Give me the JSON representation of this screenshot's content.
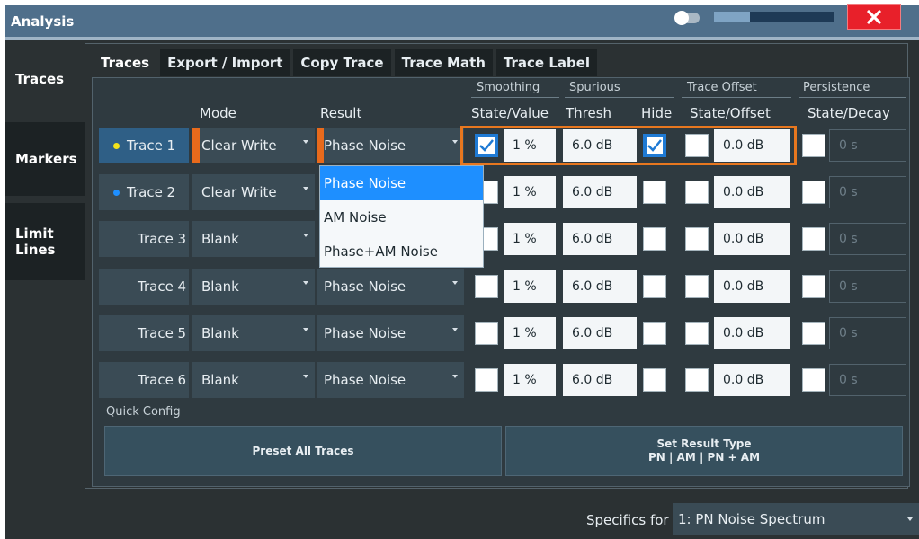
{
  "window": {
    "title": "Analysis",
    "brightness_level": 0.3,
    "colors": {
      "accent": "#e8771f",
      "selection": "#1e8fff",
      "close": "#e8202a"
    }
  },
  "sidebar": {
    "items": [
      {
        "label": "Traces",
        "active": true
      },
      {
        "label": "Markers"
      },
      {
        "label": "Limit Lines"
      }
    ]
  },
  "tabs": [
    {
      "label": "Traces",
      "active": true
    },
    {
      "label": "Export / Import"
    },
    {
      "label": "Copy Trace"
    },
    {
      "label": "Trace Math"
    },
    {
      "label": "Trace Label"
    }
  ],
  "headers": {
    "groups": {
      "smoothing": "Smoothing",
      "spurious": "Spurious",
      "trace_offset": "Trace Offset",
      "persistence": "Persistence"
    },
    "mode": "Mode",
    "result": "Result",
    "state_value": "State/Value",
    "thresh": "Thresh",
    "hide": "Hide",
    "state_offset": "State/Offset",
    "state_decay": "State/Decay"
  },
  "traces": [
    {
      "label": "Trace 1",
      "dot": "#f2e21a",
      "mode": "Clear Write",
      "result": "Phase Noise",
      "smoothing_on": true,
      "smoothing": "1 %",
      "thresh": "6.0 dB",
      "hide": true,
      "offset_on": false,
      "offset": "0.0 dB",
      "persist_on": false,
      "decay": "0 s"
    },
    {
      "label": "Trace 2",
      "dot": "#1e8fff",
      "mode": "Clear Write",
      "result": "",
      "smoothing_on": false,
      "smoothing": "1 %",
      "thresh": "6.0 dB",
      "hide": false,
      "offset_on": false,
      "offset": "0.0 dB",
      "persist_on": false,
      "decay": "0 s"
    },
    {
      "label": "Trace 3",
      "dot": "",
      "mode": "Blank",
      "result": "",
      "smoothing_on": false,
      "smoothing": "1 %",
      "thresh": "6.0 dB",
      "hide": false,
      "offset_on": false,
      "offset": "0.0 dB",
      "persist_on": false,
      "decay": "0 s"
    },
    {
      "label": "Trace 4",
      "dot": "",
      "mode": "Blank",
      "result": "Phase Noise",
      "smoothing_on": false,
      "smoothing": "1 %",
      "thresh": "6.0 dB",
      "hide": false,
      "offset_on": false,
      "offset": "0.0 dB",
      "persist_on": false,
      "decay": "0 s"
    },
    {
      "label": "Trace 5",
      "dot": "",
      "mode": "Blank",
      "result": "Phase Noise",
      "smoothing_on": false,
      "smoothing": "1 %",
      "thresh": "6.0 dB",
      "hide": false,
      "offset_on": false,
      "offset": "0.0 dB",
      "persist_on": false,
      "decay": "0 s"
    },
    {
      "label": "Trace 6",
      "dot": "",
      "mode": "Blank",
      "result": "Phase Noise",
      "smoothing_on": false,
      "smoothing": "1 %",
      "thresh": "6.0 dB",
      "hide": false,
      "offset_on": false,
      "offset": "0.0 dB",
      "persist_on": false,
      "decay": "0 s"
    }
  ],
  "dropdown": {
    "options": [
      "Phase Noise",
      "AM Noise",
      "Phase+AM Noise"
    ],
    "highlighted": 0
  },
  "quick_config": {
    "label": "Quick Config",
    "preset_label": "Preset All Traces",
    "set_result_label": "Set Result Type",
    "set_result_sub": "PN | AM | PN + AM"
  },
  "footer": {
    "specifics_label": "Specifics for",
    "specifics_value": "1: PN Noise Spectrum"
  }
}
